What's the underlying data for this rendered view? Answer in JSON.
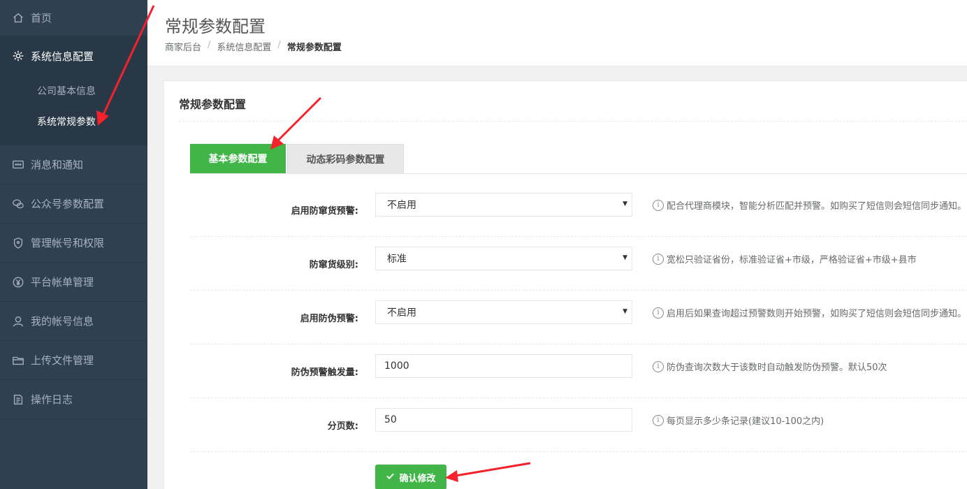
{
  "sidebar": {
    "home": "首页",
    "group": {
      "label": "系统信息配置",
      "subitems": [
        "公司基本信息",
        "系统常规参数"
      ]
    },
    "items": [
      {
        "label": "消息和通知",
        "icon": "message-icon"
      },
      {
        "label": "公众号参数配置",
        "icon": "wechat-icon"
      },
      {
        "label": "管理帐号和权限",
        "icon": "shield-icon"
      },
      {
        "label": "平台帐单管理",
        "icon": "yen-icon"
      },
      {
        "label": "我的帐号信息",
        "icon": "user-icon"
      },
      {
        "label": "上传文件管理",
        "icon": "folder-icon"
      },
      {
        "label": "操作日志",
        "icon": "log-icon"
      }
    ]
  },
  "header": {
    "title": "常规参数配置",
    "breadcrumb": [
      "商家后台",
      "系统信息配置",
      "常规参数配置"
    ],
    "separator": "/"
  },
  "panel": {
    "title": "常规参数配置",
    "tabs": [
      "基本参数配置",
      "动态彩码参数配置"
    ],
    "fields": [
      {
        "label": "启用防窜货预警:",
        "value": "不启用",
        "help": "配合代理商模块，智能分析匹配并预警。如购买了短信则会短信同步通知。"
      },
      {
        "label": "防窜货级别:",
        "value": "标准",
        "help": "宽松只验证省份，标准验证省+市级，严格验证省+市级+县市"
      },
      {
        "label": "启用防伪预警:",
        "value": "不启用",
        "help": "启用后如果查询超过预警数则开始预警，如购买了短信则会短信同步通知。"
      },
      {
        "label": "防伪预警触发量:",
        "value": "1000",
        "help": "防伪查询次数大于该数时自动触发防伪预警。默认50次"
      },
      {
        "label": "分页数:",
        "value": "50",
        "help": "每页显示多少条记录(建议10-100之内)"
      }
    ],
    "info_glyph": "i",
    "caret": "▼",
    "submit": "确认修改"
  },
  "colors": {
    "sidebar_bg": "#2f4050",
    "accent_green": "#42b549",
    "arrow_red": "#f5222d"
  }
}
